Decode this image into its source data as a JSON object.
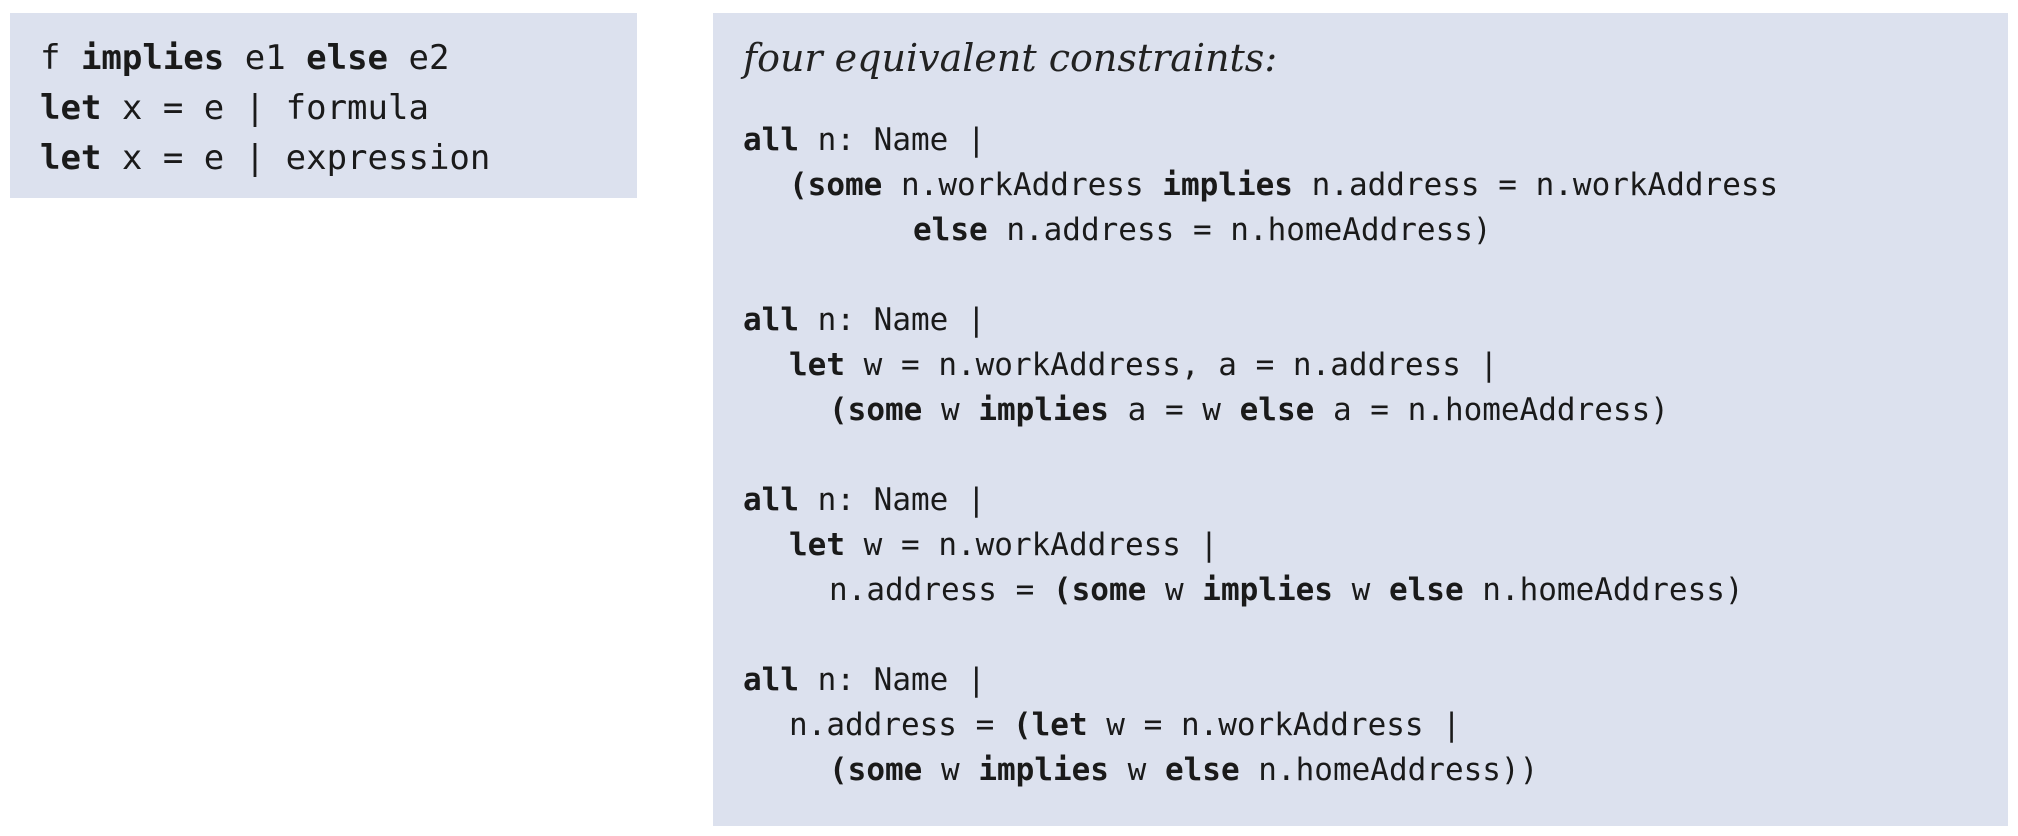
{
  "syntax": [
    [
      {
        "t": "f "
      },
      {
        "t": "implies",
        "b": true
      },
      {
        "t": " e1 "
      },
      {
        "t": "else",
        "b": true
      },
      {
        "t": " e2"
      }
    ],
    [
      {
        "t": "let",
        "b": true
      },
      {
        "t": " x = e | formula"
      }
    ],
    [
      {
        "t": "let",
        "b": true
      },
      {
        "t": " x = e | expression"
      }
    ]
  ],
  "examples": {
    "heading": "four equivalent constraints:",
    "blocks": [
      [
        {
          "indent": 0,
          "tokens": [
            {
              "t": "all",
              "b": true
            },
            {
              "t": " n: Name |"
            }
          ]
        },
        {
          "indent": 1,
          "tokens": [
            {
              "t": "(some",
              "b": true
            },
            {
              "t": " n.workAddress "
            },
            {
              "t": "implies",
              "b": true
            },
            {
              "t": " n.address = n.workAddress"
            }
          ]
        },
        {
          "indent": 3,
          "tokens": [
            {
              "t": "else",
              "b": true
            },
            {
              "t": " n.address = n.homeAddress)"
            }
          ]
        }
      ],
      [
        {
          "indent": 0,
          "tokens": [
            {
              "t": "all",
              "b": true
            },
            {
              "t": " n: Name |"
            }
          ]
        },
        {
          "indent": 1,
          "tokens": [
            {
              "t": "let",
              "b": true
            },
            {
              "t": " w = n.workAddress, a = n.address |"
            }
          ]
        },
        {
          "indent": 2,
          "tokens": [
            {
              "t": "(some",
              "b": true
            },
            {
              "t": " w "
            },
            {
              "t": "implies",
              "b": true
            },
            {
              "t": " a = w "
            },
            {
              "t": "else",
              "b": true
            },
            {
              "t": " a = n.homeAddress)"
            }
          ]
        }
      ],
      [
        {
          "indent": 0,
          "tokens": [
            {
              "t": "all",
              "b": true
            },
            {
              "t": " n: Name |"
            }
          ]
        },
        {
          "indent": 1,
          "tokens": [
            {
              "t": "let",
              "b": true
            },
            {
              "t": " w = n.workAddress |"
            }
          ]
        },
        {
          "indent": 2,
          "tokens": [
            {
              "t": "n.address = "
            },
            {
              "t": "(some",
              "b": true
            },
            {
              "t": " w "
            },
            {
              "t": "implies",
              "b": true
            },
            {
              "t": " w "
            },
            {
              "t": "else",
              "b": true
            },
            {
              "t": " n.homeAddress)"
            }
          ]
        }
      ],
      [
        {
          "indent": 0,
          "tokens": [
            {
              "t": "all",
              "b": true
            },
            {
              "t": " n: Name |"
            }
          ]
        },
        {
          "indent": 1,
          "tokens": [
            {
              "t": "n.address = "
            },
            {
              "t": "(let",
              "b": true
            },
            {
              "t": " w = n.workAddress |"
            }
          ]
        },
        {
          "indent": 2,
          "tokens": [
            {
              "t": "(some",
              "b": true
            },
            {
              "t": " w "
            },
            {
              "t": "implies",
              "b": true
            },
            {
              "t": " w "
            },
            {
              "t": "else",
              "b": true
            },
            {
              "t": " n.homeAddress))"
            }
          ]
        }
      ]
    ]
  }
}
